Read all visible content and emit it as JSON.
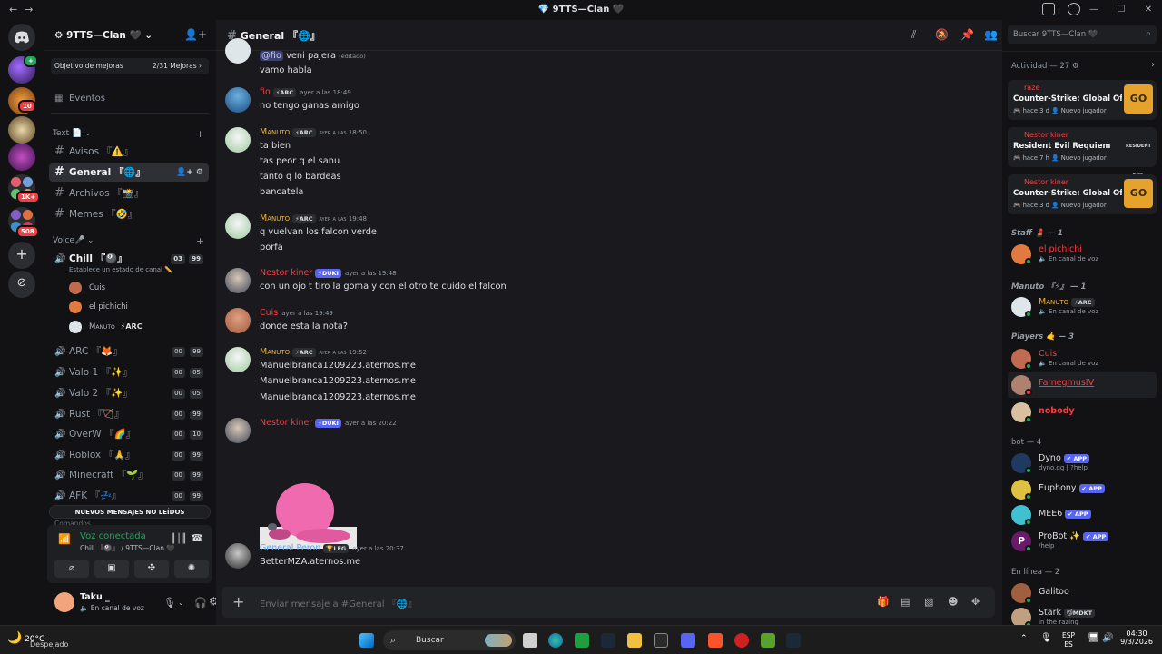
{
  "window": {
    "title": "💎 9TTS—Clan 🖤",
    "controls": [
      "—",
      "☐",
      "✕"
    ]
  },
  "rail": {
    "badges": [
      "10",
      "1K+",
      "508"
    ]
  },
  "server": {
    "name": "9TTS—Clan 🖤",
    "boost_label": "Objetivo de mejoras",
    "boost_count": "2/31 Mejoras ›",
    "events_label": "Eventos",
    "text_category": "Text 📄 ⌄",
    "voice_category": "Voice🎤 ⌄",
    "text_channels": [
      {
        "name": "Avisos 『⚠️』"
      },
      {
        "name": "General 『🌐』"
      },
      {
        "name": "Archivos 『📸』"
      },
      {
        "name": "Memes 『🤣』"
      }
    ],
    "voice_channels": [
      {
        "name": "Chill 『🎱』",
        "a": "03",
        "b": "99",
        "status": "Establece un estado de canal ✏️"
      },
      {
        "name": "ARC 『🦊』",
        "a": "00",
        "b": "99"
      },
      {
        "name": "Valo 1 『✨』",
        "a": "00",
        "b": "05"
      },
      {
        "name": "Valo 2 『✨』",
        "a": "00",
        "b": "05"
      },
      {
        "name": "Rust 『🏹』",
        "a": "00",
        "b": "99"
      },
      {
        "name": "OverW 『🌈』",
        "a": "00",
        "b": "10"
      },
      {
        "name": "Roblox 『🙏』",
        "a": "00",
        "b": "99"
      },
      {
        "name": "Minecraft 『🌱』",
        "a": "00",
        "b": "99"
      },
      {
        "name": "AFK 『💤』",
        "a": "00",
        "b": "99"
      }
    ],
    "voice_users": [
      {
        "name": "Cuis"
      },
      {
        "name": "el pichichi"
      },
      {
        "name": "Manuto",
        "tag": "⚡ARC"
      }
    ],
    "unread_banner": "NUEVOS MENSAJES NO LEÍDOS",
    "partial_category": "Comandos"
  },
  "voice_panel": {
    "status": "Voz conectada",
    "channel": "Chill 『🎱』 / 9TTS—Clan 🖤"
  },
  "user_panel": {
    "name": "Taku _",
    "status": "En canal de voz"
  },
  "channel": {
    "header": "General 『🌐』",
    "composer_placeholder": "Enviar mensaje a #General 『🌐』"
  },
  "messages": {
    "m0": {
      "mention": "@fio",
      "line": "veni pajera",
      "edited": "(editado)",
      "line2": "vamo habla"
    },
    "m1": {
      "author": "fio",
      "tag": "⚡ARC",
      "time": "ayer a las 18:49",
      "lines": [
        "no tengo ganas amigo"
      ]
    },
    "m2": {
      "author": "Manuto",
      "tag": "⚡ARC",
      "time": "ayer a las 18:50",
      "lines": [
        "ta bien",
        "tas peor q el sanu",
        "tanto q lo bardeas",
        "bancatela"
      ]
    },
    "m3": {
      "author": "Manuto",
      "tag": "⚡ARC",
      "time": "ayer a las 19:48",
      "lines": [
        "q vuelvan los falcon verde",
        "porfa"
      ]
    },
    "m4": {
      "author": "Nestor kiner",
      "tag": "⚡DUKI",
      "time": "ayer a las 19:48",
      "lines": [
        "con un ojo t tiro la goma y con el otro te cuido el falcon"
      ]
    },
    "m5": {
      "author": "Cuis",
      "time": "ayer a las 19:49",
      "lines": [
        "donde esta la nota?"
      ]
    },
    "m6": {
      "author": "Manuto",
      "tag": "⚡ARC",
      "time": "ayer a las 19:52",
      "lines": [
        "Manuelbranca1209223.aternos.me",
        "Manuelbranca1209223.aternos.me",
        "Manuelbranca1209223.aternos.me"
      ]
    },
    "m7": {
      "author": "Nestor kiner",
      "tag": "⚡DUKI",
      "time": "ayer a las 20:22"
    },
    "m8": {
      "author": "General Peron",
      "tag": "🏆LFG",
      "time": "ayer a las 20:37",
      "lines": [
        "BetterMZA.aternos.me"
      ]
    }
  },
  "members": {
    "search_placeholder": "Buscar 9TTS—Clan 🖤",
    "activity_header": "Actividad — 27 ⚙",
    "activity": [
      {
        "who": "raze",
        "game": "Counter-Strike: Global Off...",
        "meta": "🎮 hace 3 d  👤 Nuevo jugador",
        "thumb": "GO"
      },
      {
        "who": "Nestor kiner",
        "game": "Resident Evil Requiem",
        "meta": "🎮 hace 7 h  👤 Nuevo jugador",
        "thumb": "RESIDENT EVIL"
      },
      {
        "who": "Nestor kiner",
        "game": "Counter-Strike: Global Off...",
        "meta": "🎮 hace 3 d  👤 Nuevo jugador",
        "thumb": "GO"
      }
    ],
    "groups": {
      "staff": "Staff 💄 — 1",
      "manuto": "Manuto 『⚡』 — 1",
      "players": "Players 🤙 — 3",
      "bot": "bot — 4",
      "online": "En línea — 2"
    },
    "list": {
      "pichichi": {
        "name": "el pichichi",
        "status": "🔈 En canal de voz"
      },
      "manuto": {
        "name": "Manuto",
        "tag": "⚡ARC",
        "status": "🔈 En canal de voz"
      },
      "cuis": {
        "name": "Cuis",
        "status": "🔈 En canal de voz"
      },
      "famegmusiv": {
        "name": "FamegmusIV"
      },
      "nobody": {
        "name": "nobody"
      },
      "dyno": {
        "name": "Dyno",
        "tag": "✔ APP",
        "status": "dyno.gg | ?help"
      },
      "euphony": {
        "name": "Euphony",
        "tag": "✔ APP"
      },
      "mee6": {
        "name": "MEE6",
        "tag": "✔ APP"
      },
      "probot": {
        "name": "ProBot ✨",
        "tag": "✔ APP",
        "status": "/help"
      },
      "galitoo": {
        "name": "Galitoo"
      },
      "stark": {
        "name": "Stark",
        "tag": "😼MDKT",
        "status": "in the razing"
      }
    }
  },
  "taskbar": {
    "temp": "20°C",
    "weather": "Despejado",
    "search": "Buscar",
    "lang1": "ESP",
    "lang2": "ES",
    "time": "04:30",
    "date": "9/3/2026"
  },
  "colors": {
    "accent": "#5865f2",
    "online": "#23a55a",
    "author_red": "#f23f43",
    "author_yellow": "#f0b232",
    "author_blue": "#5aa7f5"
  }
}
